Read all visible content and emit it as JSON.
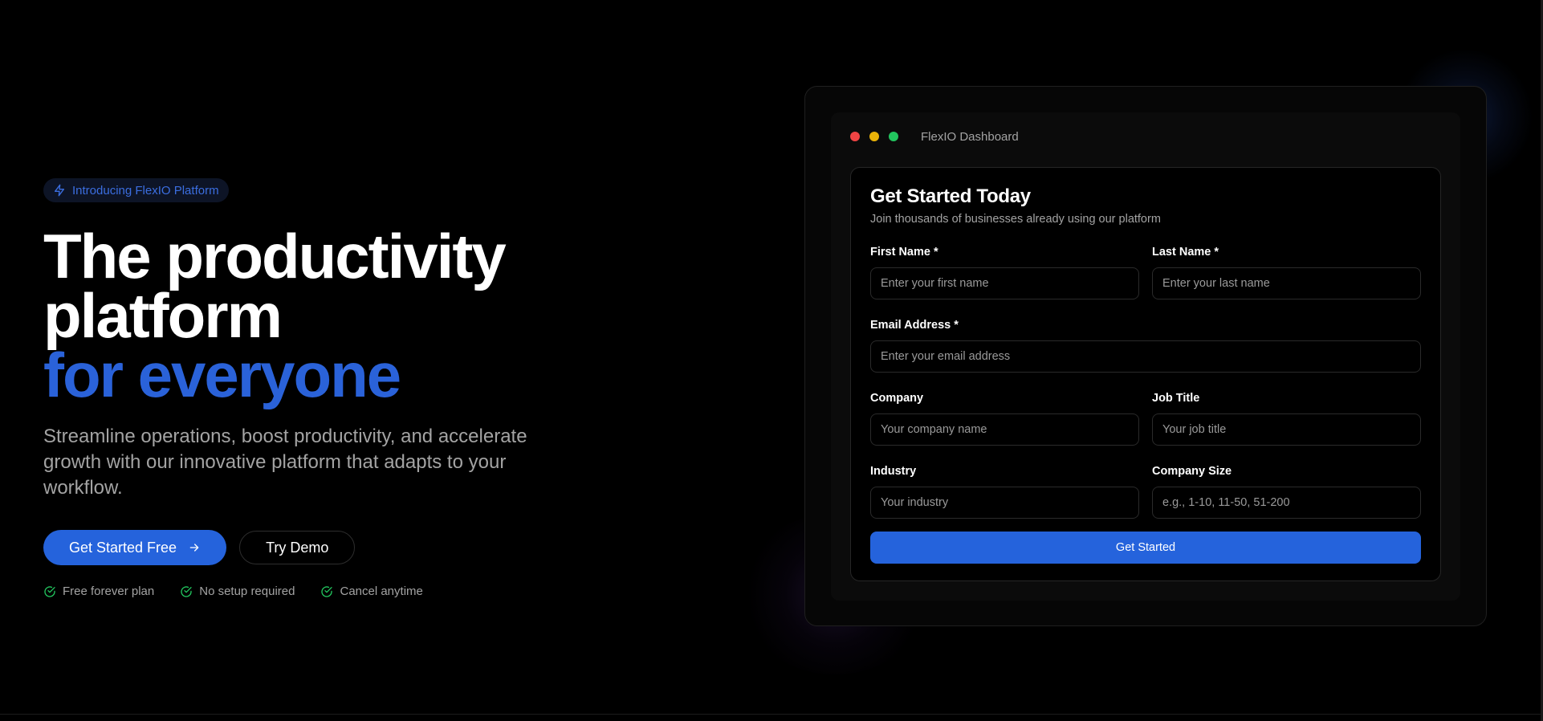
{
  "hero": {
    "badge": "Introducing FlexIO Platform",
    "headline_line1": "The productivity platform",
    "headline_line2": "for everyone",
    "subtitle": "Streamline operations, boost productivity, and accelerate growth with our innovative platform that adapts to your workflow.",
    "primary_cta": "Get Started Free",
    "secondary_cta": "Try Demo",
    "features": [
      "Free forever plan",
      "No setup required",
      "Cancel anytime"
    ]
  },
  "dashboard": {
    "window_title": "FlexIO Dashboard",
    "form": {
      "title": "Get Started Today",
      "subtitle": "Join thousands of businesses already using our platform",
      "first_name": {
        "label": "First Name *",
        "placeholder": "Enter your first name"
      },
      "last_name": {
        "label": "Last Name *",
        "placeholder": "Enter your last name"
      },
      "email": {
        "label": "Email Address *",
        "placeholder": "Enter your email address"
      },
      "company": {
        "label": "Company",
        "placeholder": "Your company name"
      },
      "job_title": {
        "label": "Job Title",
        "placeholder": "Your job title"
      },
      "industry": {
        "label": "Industry",
        "placeholder": "Your industry"
      },
      "company_size": {
        "label": "Company Size",
        "placeholder": "e.g., 1-10, 11-50, 51-200"
      },
      "submit": "Get Started"
    }
  },
  "colors": {
    "accent": "#2563dc",
    "background": "#000000",
    "muted_text": "#a3a3a3",
    "check_green": "#22c55e"
  }
}
